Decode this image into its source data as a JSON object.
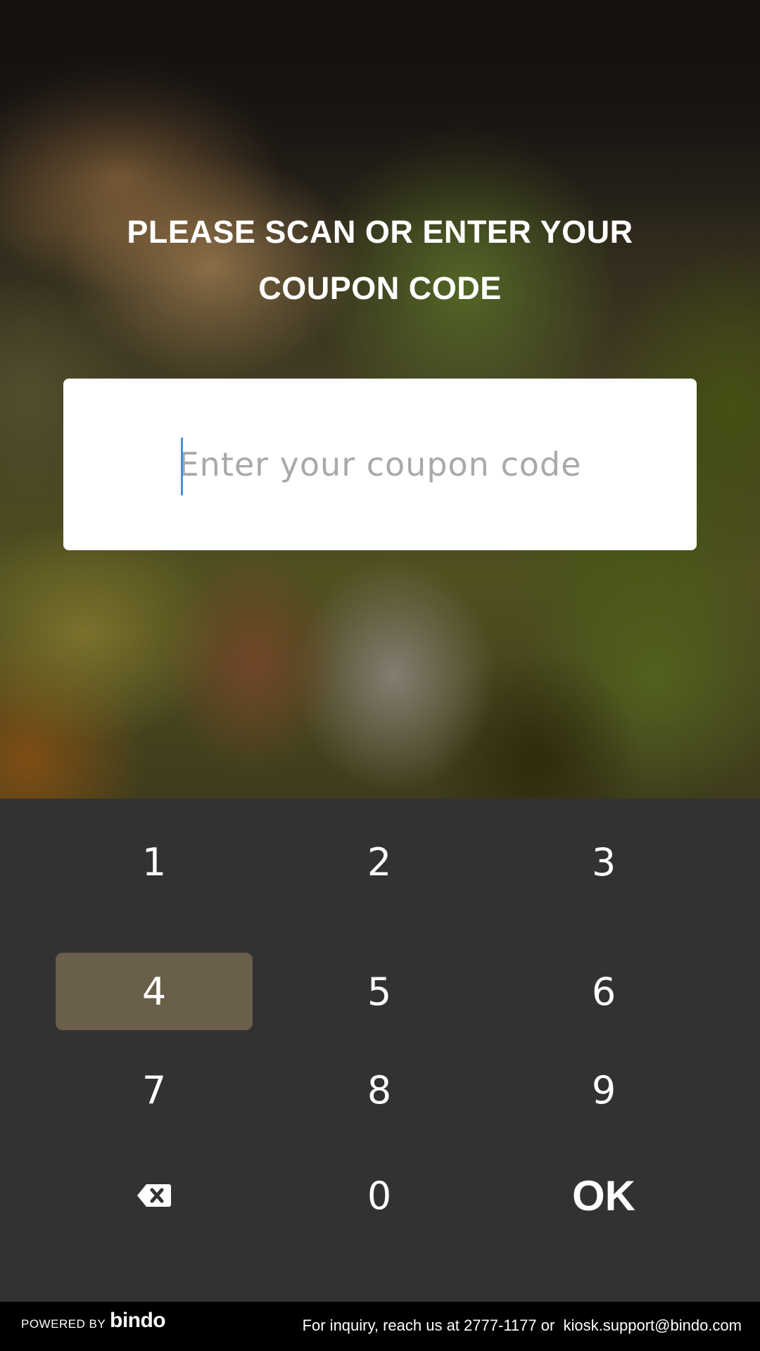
{
  "title": {
    "line1": "PLEASE SCAN OR ENTER YOUR",
    "line2": "COUPON CODE"
  },
  "coupon_input": {
    "placeholder": "Enter your coupon code",
    "value": ""
  },
  "keypad": {
    "keys": [
      "1",
      "2",
      "3",
      "4",
      "5",
      "6",
      "7",
      "8",
      "9",
      "backspace",
      "0",
      "OK"
    ],
    "active_key": "4",
    "ok_label": "OK",
    "backspace_icon": "backspace-icon"
  },
  "footer": {
    "powered_by": "POWERED BY",
    "brand": "bindo",
    "inquiry_text": "For inquiry, reach us at",
    "phone": "2777-1177",
    "or_text": "or",
    "email": "kiosk.support@bindo.com"
  },
  "colors": {
    "keypad_background": "#323232",
    "active_key": "#6a5f4a",
    "caret": "#4a90d9",
    "footer_background": "#000000"
  }
}
